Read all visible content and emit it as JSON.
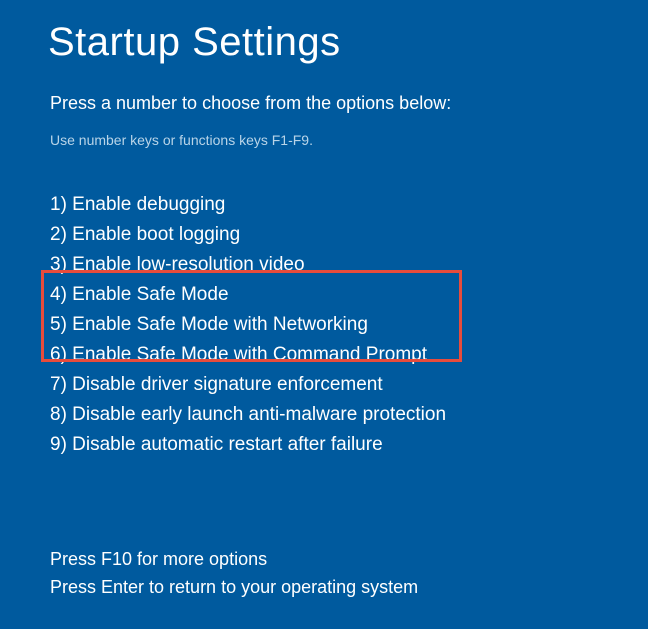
{
  "title": "Startup Settings",
  "instruction": "Press a number to choose from the options below:",
  "hint": "Use number keys or functions keys F1-F9.",
  "options": [
    "1) Enable debugging",
    "2) Enable boot logging",
    "3) Enable low-resolution video",
    "4) Enable Safe Mode",
    "5) Enable Safe Mode with Networking",
    "6) Enable Safe Mode with Command Prompt",
    "7) Disable driver signature enforcement",
    "8) Disable early launch anti-malware protection",
    "9) Disable automatic restart after failure"
  ],
  "footer": {
    "more": "Press F10 for more options",
    "return": "Press Enter to return to your operating system"
  }
}
